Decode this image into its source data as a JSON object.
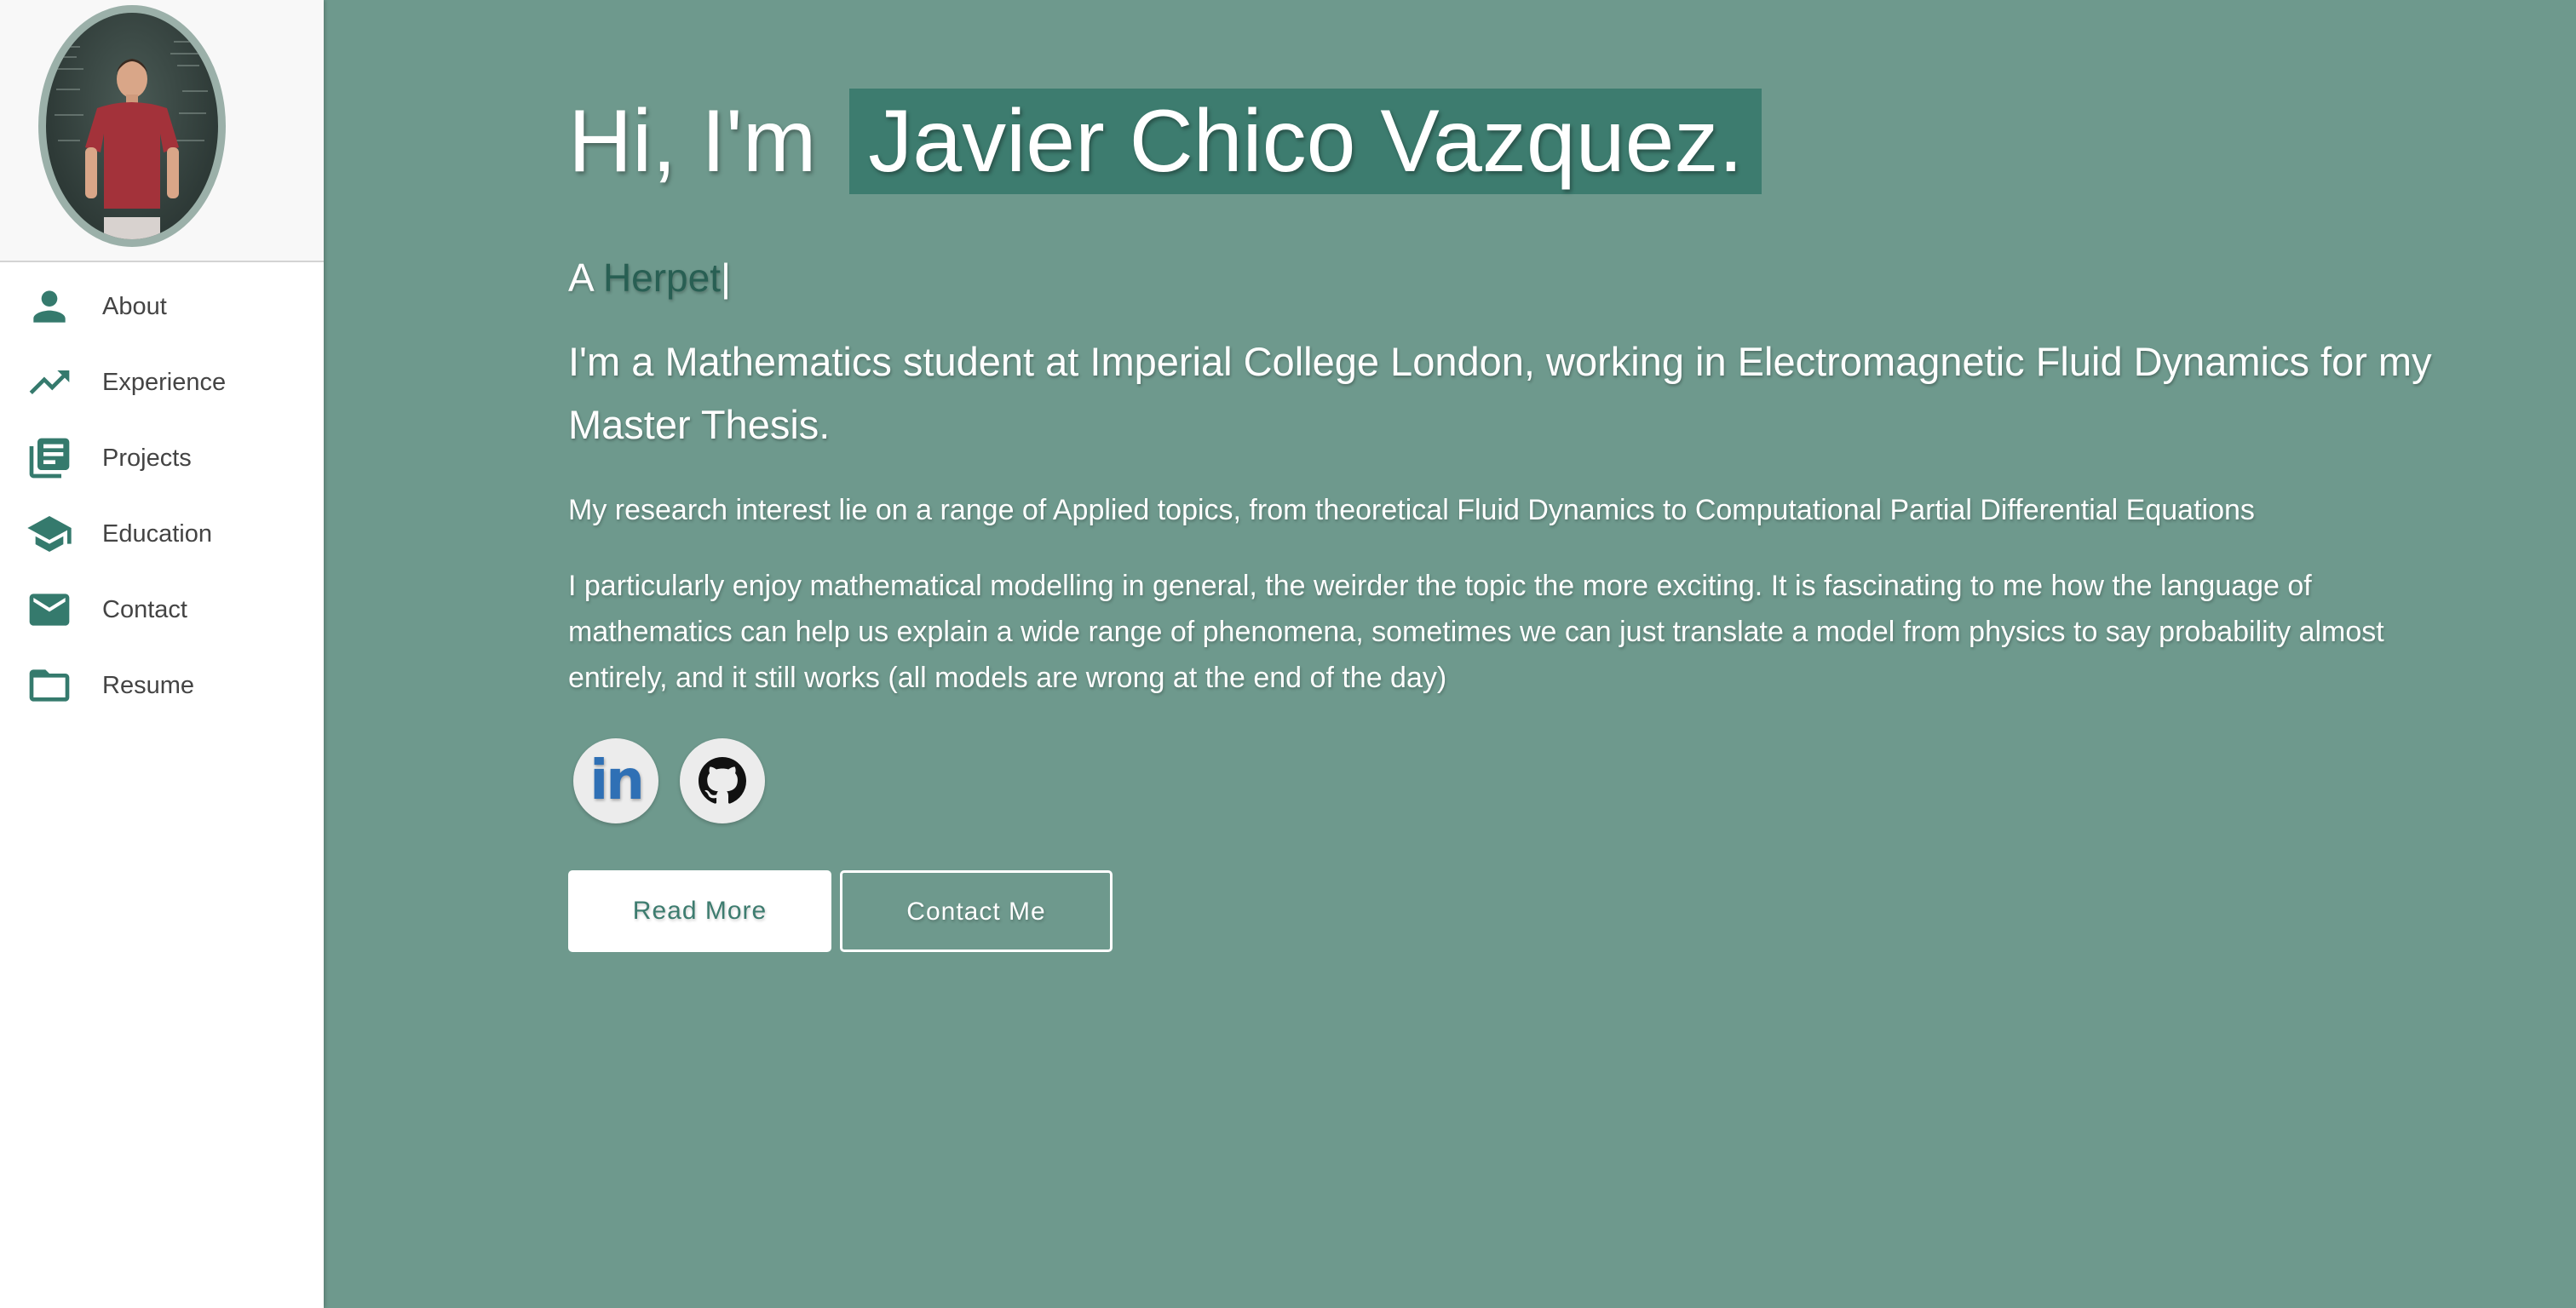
{
  "theme": {
    "accent": "#3d7c6f",
    "background": "#6e998d",
    "sidebar_background": "#ffffff",
    "icon_color": "#357a6d"
  },
  "sidebar": {
    "items": [
      {
        "label": "About",
        "icon": "person-icon"
      },
      {
        "label": "Experience",
        "icon": "trending-up-icon"
      },
      {
        "label": "Projects",
        "icon": "library-books-icon"
      },
      {
        "label": "Education",
        "icon": "graduation-cap-icon"
      },
      {
        "label": "Contact",
        "icon": "mail-icon"
      },
      {
        "label": "Resume",
        "icon": "folder-icon"
      }
    ]
  },
  "hero": {
    "greeting_prefix": "Hi, I'm",
    "name": "Javier Chico Vazquez.",
    "tagline_prefix": "A",
    "tagline_typed": "Herpet",
    "tagline_cursor": "|",
    "lead": "I'm a Mathematics student at Imperial College London, working in Electromagnetic Fluid Dynamics for my Master Thesis.",
    "paragraph_1": "My research interest lie on a range of Applied topics, from theoretical Fluid Dynamics to Computational Partial Differential Equations",
    "paragraph_2": "I particularly enjoy mathematical modelling in general, the weirder the topic the more exciting. It is fascinating to me how the language of mathematics can help us explain a wide range of phenomena, sometimes we can just translate a model from physics to say probability almost entirely, and it still works (all models are wrong at the end of the day)"
  },
  "social": {
    "linkedin_label": "in",
    "github_icon": "github-icon"
  },
  "buttons": {
    "read_more": "Read More",
    "contact_me": "Contact Me"
  }
}
